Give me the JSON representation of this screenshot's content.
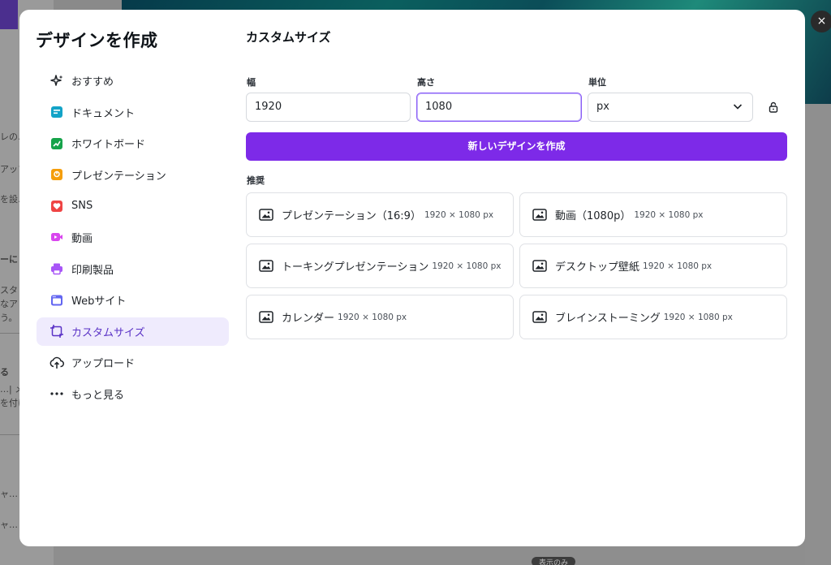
{
  "background": {
    "snippets": [
      "レの…",
      "アップ",
      "を設…",
      "ーに",
      "スタ",
      "なア",
      "う。",
      "る",
      "…| メ",
      "を付け",
      "ャ…",
      "ャ…"
    ],
    "pill": "表示のみ"
  },
  "modal": {
    "title": "デザインを作成",
    "close_icon": "×"
  },
  "nav": {
    "items": [
      {
        "label": "おすすめ",
        "icon": "sparkle-icon"
      },
      {
        "label": "ドキュメント",
        "icon": "document-icon"
      },
      {
        "label": "ホワイトボード",
        "icon": "whiteboard-icon"
      },
      {
        "label": "プレゼンテーション",
        "icon": "presentation-icon"
      },
      {
        "label": "SNS",
        "icon": "heart-icon"
      },
      {
        "label": "動画",
        "icon": "video-icon"
      },
      {
        "label": "印刷製品",
        "icon": "print-icon"
      },
      {
        "label": "Webサイト",
        "icon": "website-icon"
      },
      {
        "label": "カスタムサイズ",
        "icon": "custom-size-icon",
        "active": true
      },
      {
        "label": "アップロード",
        "icon": "upload-icon"
      },
      {
        "label": "もっと見る",
        "icon": "more-icon"
      }
    ]
  },
  "custom": {
    "title": "カスタムサイズ",
    "width_label": "幅",
    "width_value": "1920",
    "height_label": "高さ",
    "height_value": "1080",
    "unit_label": "単位",
    "unit_value": "px",
    "create_button": "新しいデザインを作成",
    "recommended_label": "推奨"
  },
  "recommended": [
    {
      "name": "プレゼンテーション（16:9）",
      "size": "1920 × 1080 px"
    },
    {
      "name": "動画（1080p）",
      "size": "1920 × 1080 px"
    },
    {
      "name": "トーキングプレゼンテーション",
      "size": "1920 × 1080 px"
    },
    {
      "name": "デスクトップ壁紙",
      "size": "1920 × 1080 px"
    },
    {
      "name": "カレンダー",
      "size": "1920 × 1080 px"
    },
    {
      "name": "ブレインストーミング",
      "size": "1920 × 1080 px"
    }
  ],
  "colors": {
    "accent": "#7d2ae8",
    "active_nav_bg": "#efebfd",
    "document": "#13a3c7",
    "whiteboard": "#16a34a",
    "presentation": "#f59e0b",
    "sns": "#ef4444",
    "video": "#d946ef",
    "print": "#a855f7",
    "website": "#6366f1"
  }
}
